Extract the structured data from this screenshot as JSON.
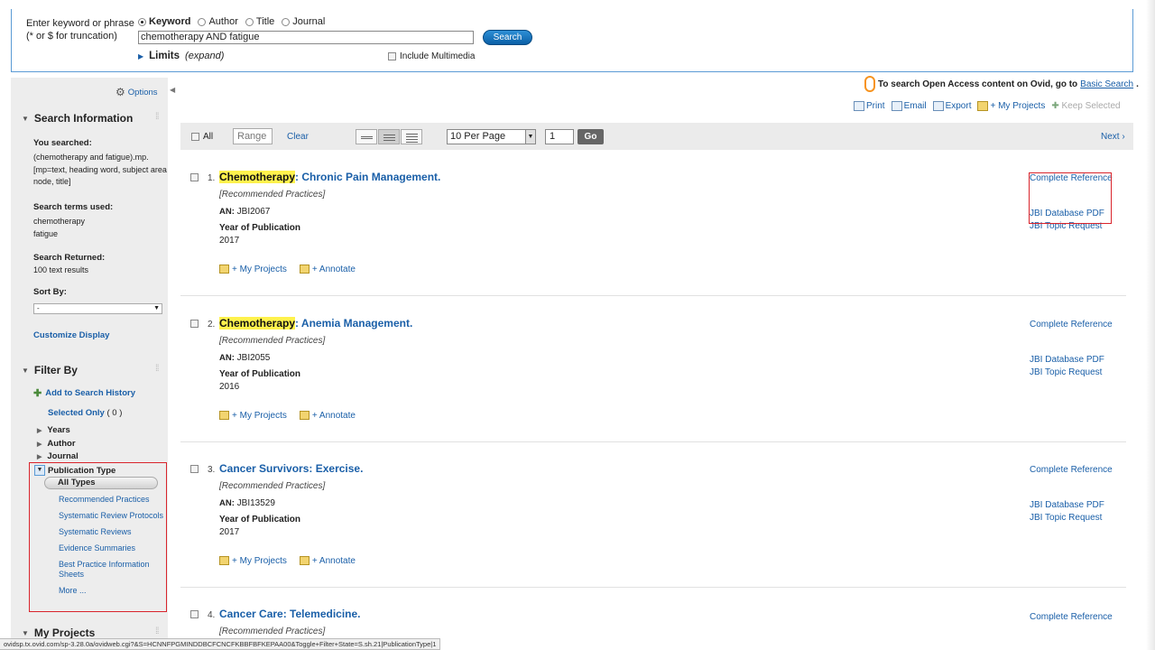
{
  "search": {
    "prompt_line1": "Enter keyword or phrase",
    "prompt_line2": "(* or $ for truncation)",
    "modes": [
      "Keyword",
      "Author",
      "Title",
      "Journal"
    ],
    "selected_mode": "Keyword",
    "query": "chemotherapy AND fatigue",
    "button": "Search",
    "limits_label": "Limits",
    "limits_expand": "(expand)",
    "include_multimedia": "Include Multimedia"
  },
  "sidebar": {
    "options": "Options",
    "search_info": {
      "heading": "Search Information",
      "you_searched_label": "You searched:",
      "you_searched_value": "(chemotherapy and fatigue).mp. [mp=text, heading word, subject area node, title]",
      "terms_label": "Search terms used:",
      "terms": [
        "chemotherapy",
        "fatigue"
      ],
      "returned_label": "Search Returned:",
      "returned_value": "100 text results",
      "sort_label": "Sort By:",
      "sort_value": "-",
      "customize": "Customize Display"
    },
    "filter": {
      "heading": "Filter By",
      "add_history": "Add to Search History",
      "selected_only": "Selected Only",
      "selected_count": "( 0 )",
      "facets": [
        "Years",
        "Author",
        "Journal"
      ],
      "pubtype_label": "Publication Type",
      "all_types": "All Types",
      "pubtypes": [
        "Recommended Practices",
        "Systematic Review Protocols",
        "Systematic Reviews",
        "Evidence Summaries",
        "Best Practice Information Sheets",
        "More ..."
      ]
    },
    "my_projects": "My Projects"
  },
  "open_access": {
    "text": "To search Open Access content on Ovid, go to",
    "link": "Basic Search",
    "period": "."
  },
  "tools": {
    "print": "Print",
    "email": "Email",
    "export": "Export",
    "my_projects": "+ My Projects",
    "keep_selected": "Keep Selected"
  },
  "toolbar": {
    "all": "All",
    "range": "Range",
    "clear": "Clear",
    "per_page": "10 Per Page",
    "page": "1",
    "go": "Go",
    "next": "Next ›"
  },
  "results": [
    {
      "num": "1.",
      "title_hl": "Chemotherapy",
      "title_rest": ": Chronic Pain Management.",
      "pub": "[Recommended Practices]",
      "an": "JBI2067",
      "year": "2017"
    },
    {
      "num": "2.",
      "title_hl": "Chemotherapy",
      "title_rest": ": Anemia Management.",
      "pub": "[Recommended Practices]",
      "an": "JBI2055",
      "year": "2016"
    },
    {
      "num": "3.",
      "title_hl": "",
      "title_rest": "Cancer Survivors: Exercise.",
      "pub": "[Recommended Practices]",
      "an": "JBI13529",
      "year": "2017"
    },
    {
      "num": "4.",
      "title_hl": "",
      "title_rest": "Cancer Care: Telemedicine.",
      "pub": "[Recommended Practices]",
      "an": "",
      "year": ""
    }
  ],
  "result_labels": {
    "an_label": "AN:",
    "year_label": "Year of Publication",
    "my_projects": "+ My Projects",
    "annotate": "+ Annotate",
    "complete_ref": "Complete Reference",
    "db_pdf": "JBI Database PDF",
    "topic_request": "JBI Topic Request"
  },
  "status_url": "ovidsp.tx.ovid.com/sp-3.28.0a/ovidweb.cgi?&S=HCNNFPGMINDDBCFCNCFKBBFBFKEPAA00&Toggle+Filter+State=S.sh.21|PublicationType|1"
}
